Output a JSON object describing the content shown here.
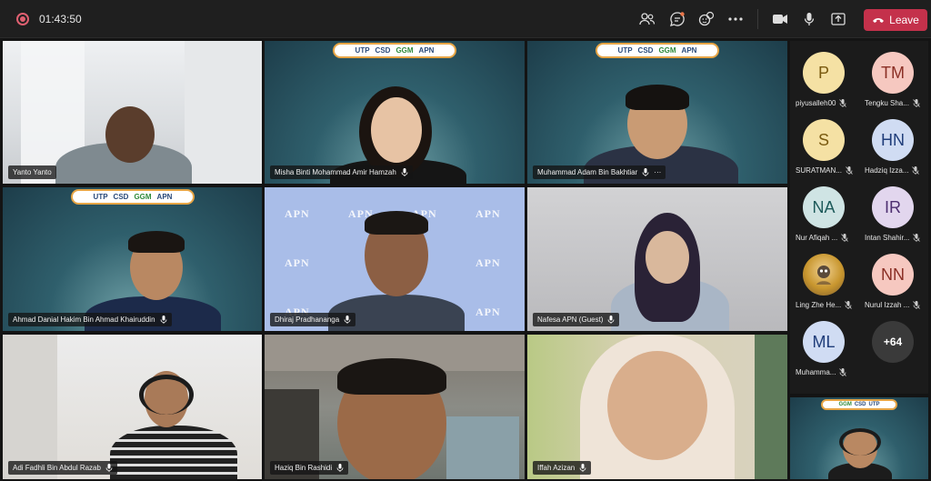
{
  "meeting": {
    "timer": "01:43:50"
  },
  "toolbar": {
    "icons": [
      "people-icon",
      "chat-icon",
      "reactions-icon",
      "more-icon",
      "camera-icon",
      "mic-icon",
      "share-icon"
    ],
    "leave_label": "Leave"
  },
  "tiles": [
    {
      "name": "Yanto Yanto"
    },
    {
      "name": "Misha Binti Mohammad Amir Hamzah"
    },
    {
      "name": "Muhammad Adam Bin Bakhtiar"
    },
    {
      "name": "Ahmad Danial Hakim Bin Ahmad Khairuddin"
    },
    {
      "name": "Dhiraj Pradhananga"
    },
    {
      "name": "Nafesa APN (Guest)"
    },
    {
      "name": "Adi Fadhli Bin Abdul Razab"
    },
    {
      "name": "Haziq Bin Rashidi"
    },
    {
      "name": "Iffah Azizan"
    }
  ],
  "banner": {
    "utp": "UTP",
    "csd": "CSD",
    "ggm": "GGM",
    "apn": "APN"
  },
  "apn_wall_text": "APN",
  "participants": [
    {
      "initials": "P",
      "name": "piyusalleh00",
      "color": "#f5e1a4",
      "text_color": "#7a5a10"
    },
    {
      "initials": "TM",
      "name": "Tengku Sha...",
      "color": "#f6c8c0",
      "text_color": "#8b2f25"
    },
    {
      "initials": "S",
      "name": "SURATMAN...",
      "color": "#f5e1a4",
      "text_color": "#7a5a10"
    },
    {
      "initials": "HN",
      "name": "Hadziq Izza...",
      "color": "#d0dcf3",
      "text_color": "#1f3d7a"
    },
    {
      "initials": "NA",
      "name": "Nur Afiqah ...",
      "color": "#cfe4e4",
      "text_color": "#1d5a5a"
    },
    {
      "initials": "IR",
      "name": "Intan Shahir...",
      "color": "#e2d6ee",
      "text_color": "#4d2f70"
    },
    {
      "initials": "",
      "name": "Ling Zhe He...",
      "color": "#e8b54a",
      "text_color": "#333"
    },
    {
      "initials": "NN",
      "name": "Nurul Izzah ...",
      "color": "#f6c8c0",
      "text_color": "#8b2f25"
    },
    {
      "initials": "ML",
      "name": "Muhamma...",
      "color": "#d0dcf3",
      "text_color": "#1f3d7a"
    }
  ],
  "overflow_count": "+64"
}
